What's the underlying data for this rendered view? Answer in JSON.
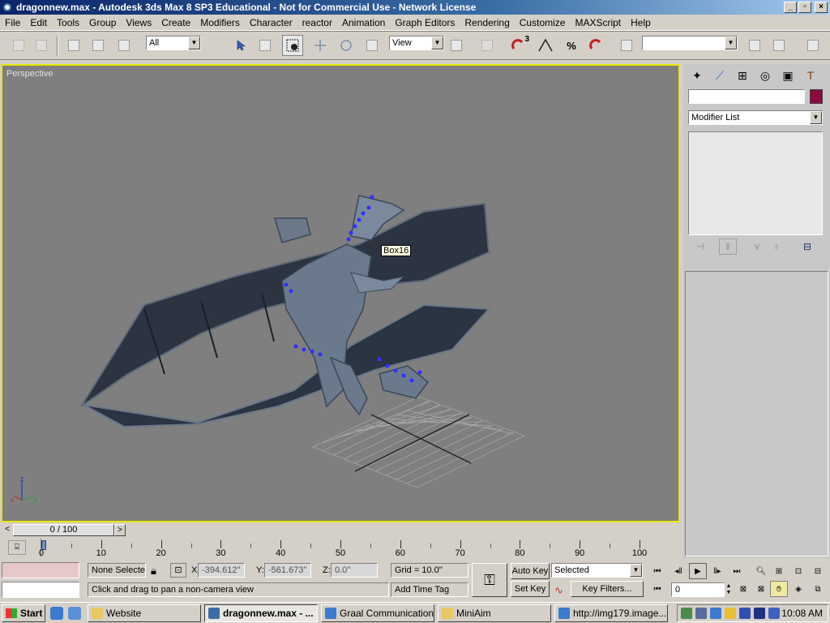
{
  "window": {
    "title": "dragonnew.max - Autodesk 3ds Max 8 SP3  Educational - Not for Commercial Use - Network License",
    "minimize": "_",
    "maximize": "▫",
    "close": "×"
  },
  "menu": [
    "File",
    "Edit",
    "Tools",
    "Group",
    "Views",
    "Create",
    "Modifiers",
    "Character",
    "reactor",
    "Animation",
    "Graph Editors",
    "Rendering",
    "Customize",
    "MAXScript",
    "Help"
  ],
  "toolbar": {
    "selection_filter": "All",
    "reference_coord": "View",
    "snap_label": "3",
    "percent_snap": "%",
    "named_selection": ""
  },
  "viewport": {
    "label": "Perspective",
    "tooltip": "Box16",
    "axis_labels": {
      "z": "z",
      "x": "x",
      "y": "y"
    },
    "colors": {
      "background": "#7f7f7f",
      "active_border": "#e8e600",
      "selection_vertices": "#3030ff"
    }
  },
  "command_panel": {
    "tabs": [
      "create-icon",
      "modify-icon",
      "hierarchy-icon",
      "motion-icon",
      "display-icon",
      "utilities-icon"
    ],
    "object_name": "",
    "object_color": "#8b0a3e",
    "modifier_list": "Modifier List"
  },
  "time": {
    "slider_label": "0 / 100",
    "ticks": [
      "0",
      "10",
      "20",
      "30",
      "40",
      "50",
      "60",
      "70",
      "80",
      "90",
      "100"
    ]
  },
  "status": {
    "selection": "None Selecte",
    "x_label": "X:",
    "x_value": "-394.612''",
    "y_label": "Y:",
    "y_value": "-561.673''",
    "z_label": "Z:",
    "z_value": "0.0''",
    "grid": "Grid = 10.0''",
    "add_time_tag": "Add Time Tag",
    "prompt": "Click and drag to pan a non-camera view",
    "auto_key": "Auto Key",
    "set_key": "Set Key",
    "key_mode": "Selected",
    "key_filters": "Key Filters...",
    "current_frame": "0"
  },
  "taskbar": {
    "start": "Start",
    "tasks": [
      "Website",
      "dragonnew.max - ...",
      "Graal Communication...",
      "MiniAim",
      "http://img179.image..."
    ],
    "clock": "10:08 AM"
  }
}
